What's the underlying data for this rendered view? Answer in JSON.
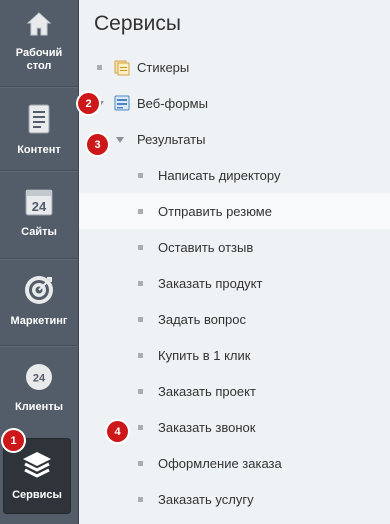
{
  "sidebar": {
    "items": [
      {
        "label": "Рабочий стол",
        "icon": "home-icon"
      },
      {
        "label": "Контент",
        "icon": "document-icon"
      },
      {
        "label": "Сайты",
        "icon": "calendar-24-icon"
      },
      {
        "label": "Маркетинг",
        "icon": "target-icon"
      },
      {
        "label": "Клиенты",
        "icon": "clock-24-icon"
      },
      {
        "label": "Сервисы",
        "icon": "layers-icon",
        "active": true
      }
    ]
  },
  "main": {
    "title": "Сервисы",
    "tree": [
      {
        "label": "Стикеры",
        "icon": "stickers-icon"
      },
      {
        "label": "Веб-формы",
        "icon": "webform-icon"
      },
      {
        "label": "Результаты"
      },
      {
        "label": "Написать директору"
      },
      {
        "label": "Отправить резюме"
      },
      {
        "label": "Оставить отзыв"
      },
      {
        "label": "Заказать продукт"
      },
      {
        "label": "Задать вопрос"
      },
      {
        "label": "Купить в 1 клик"
      },
      {
        "label": "Заказать проект"
      },
      {
        "label": "Заказать звонок"
      },
      {
        "label": "Оформление заказа"
      },
      {
        "label": "Заказать услугу"
      }
    ]
  },
  "badges": [
    "1",
    "2",
    "3",
    "4"
  ],
  "colors": {
    "sidebar_bg": "#535c69",
    "sidebar_active_bg": "#2f343b",
    "main_bg": "#eef2f4",
    "badge_red": "#cc1818"
  }
}
